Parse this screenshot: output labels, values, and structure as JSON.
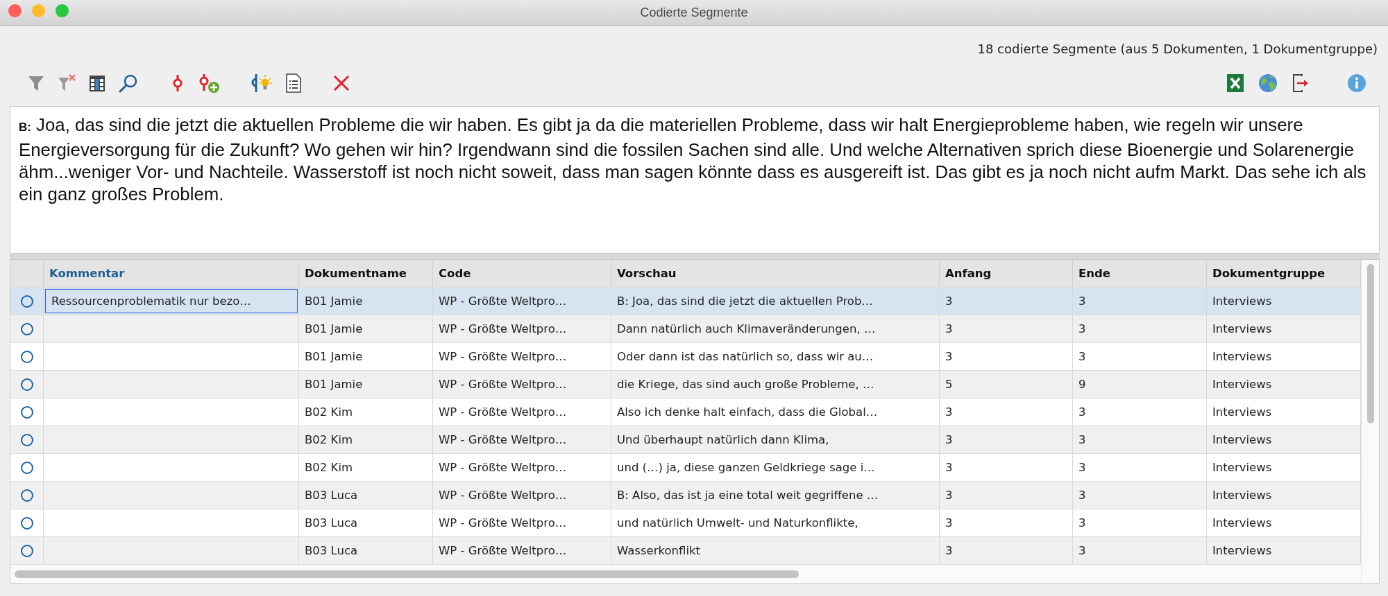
{
  "window": {
    "title": "Codierte Segmente"
  },
  "summary": "18 codierte Segmente (aus 5 Dokumenten, 1 Dokumentgruppe)",
  "preview": {
    "speaker": "B:",
    "text": "Joa, das sind die jetzt die aktuellen Probleme die wir haben. Es gibt ja da die materiellen Probleme, dass wir halt Energieprobleme haben, wie regeln wir unsere Energieversorgung für die Zukunft? Wo gehen wir hin? Irgendwann sind die fossilen Sachen sind alle. Und welche Alternativen sprich diese Bioenergie und Solarenergie ähm...weniger Vor- und Nachteile. Wasserstoff ist noch nicht soweit, dass man sagen könnte dass es ausgereift ist. Das gibt es ja noch nicht aufm Markt. Das sehe ich als ein ganz großes Problem."
  },
  "table": {
    "columns": [
      {
        "label": "Kommentar",
        "active": true
      },
      {
        "label": "Dokumentname",
        "active": false
      },
      {
        "label": "Code",
        "active": false
      },
      {
        "label": "Vorschau",
        "active": false
      },
      {
        "label": "Anfang",
        "active": false
      },
      {
        "label": "Ende",
        "active": false
      },
      {
        "label": "Dokumentgruppe",
        "active": false
      }
    ],
    "rows": [
      {
        "selected": true,
        "cells": [
          "Ressourcenproblematik nur bezo…",
          "B01 Jamie",
          "WP - Größte Weltpro…",
          "B: Joa, das sind die jetzt die aktuellen Prob…",
          "3",
          "3",
          "Interviews"
        ]
      },
      {
        "selected": false,
        "cells": [
          "",
          "B01 Jamie",
          "WP - Größte Weltpro…",
          "Dann natürlich auch Klimaveränderungen, …",
          "3",
          "3",
          "Interviews"
        ]
      },
      {
        "selected": false,
        "cells": [
          "",
          "B01 Jamie",
          "WP - Größte Weltpro…",
          "Oder dann ist das natürlich so, dass wir au…",
          "3",
          "3",
          "Interviews"
        ]
      },
      {
        "selected": false,
        "cells": [
          "",
          "B01 Jamie",
          "WP - Größte Weltpro…",
          "die Kriege, das sind auch große Probleme, …",
          "5",
          "9",
          "Interviews"
        ]
      },
      {
        "selected": false,
        "cells": [
          "",
          "B02 Kim",
          "WP - Größte Weltpro…",
          "Also ich denke halt einfach, dass die Global…",
          "3",
          "3",
          "Interviews"
        ]
      },
      {
        "selected": false,
        "cells": [
          "",
          "B02 Kim",
          "WP - Größte Weltpro…",
          "Und überhaupt natürlich dann Klima,",
          "3",
          "3",
          "Interviews"
        ]
      },
      {
        "selected": false,
        "cells": [
          "",
          "B02 Kim",
          "WP - Größte Weltpro…",
          "und (…) ja, diese ganzen Geldkriege sage i…",
          "3",
          "3",
          "Interviews"
        ]
      },
      {
        "selected": false,
        "cells": [
          "",
          "B03 Luca",
          "WP - Größte Weltpro…",
          "B: Also, das ist ja eine total weit gegriffene …",
          "3",
          "3",
          "Interviews"
        ]
      },
      {
        "selected": false,
        "cells": [
          "",
          "B03 Luca",
          "WP - Größte Weltpro…",
          "und natürlich Umwelt- und Naturkonflikte,",
          "3",
          "3",
          "Interviews"
        ]
      },
      {
        "selected": false,
        "cells": [
          "",
          "B03 Luca",
          "WP - Größte Weltpro…",
          "Wasserkonflikt",
          "3",
          "3",
          "Interviews"
        ]
      }
    ]
  }
}
